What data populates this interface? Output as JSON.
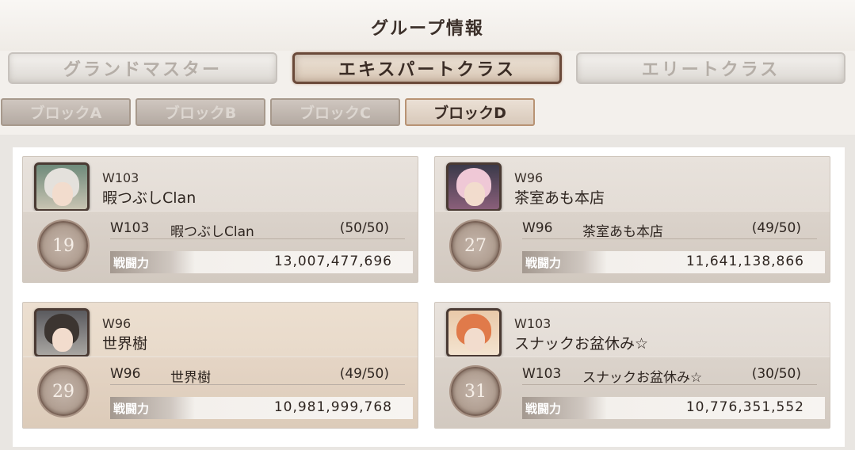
{
  "header": {
    "title": "グループ情報"
  },
  "class_tabs": [
    {
      "label": "グランドマスター",
      "active": false
    },
    {
      "label": "エキスパートクラス",
      "active": true
    },
    {
      "label": "エリートクラス",
      "active": false
    }
  ],
  "block_tabs": [
    {
      "label": "ブロックA",
      "active": false
    },
    {
      "label": "ブロックB",
      "active": false
    },
    {
      "label": "ブロックC",
      "active": false
    },
    {
      "label": "ブロックD",
      "active": true
    }
  ],
  "power_label": "戦闘力",
  "guilds": [
    {
      "server": "W103",
      "name": "暇つぶしClan",
      "rank": "19",
      "members": "(50/50)",
      "power": "13,007,477,696"
    },
    {
      "server": "W96",
      "name": "茶室あも本店",
      "rank": "27",
      "members": "(49/50)",
      "power": "11,641,138,866"
    },
    {
      "server": "W96",
      "name": "世界樹",
      "rank": "29",
      "members": "(49/50)",
      "power": "10,981,999,768"
    },
    {
      "server": "W103",
      "name": "スナックお盆休み☆",
      "rank": "31",
      "members": "(30/50)",
      "power": "10,776,351,552"
    }
  ],
  "colors": {
    "accent": "#6b4a3a",
    "card_bg": "#e4ddd6",
    "card_bg_highlight": "#e8dac9"
  }
}
